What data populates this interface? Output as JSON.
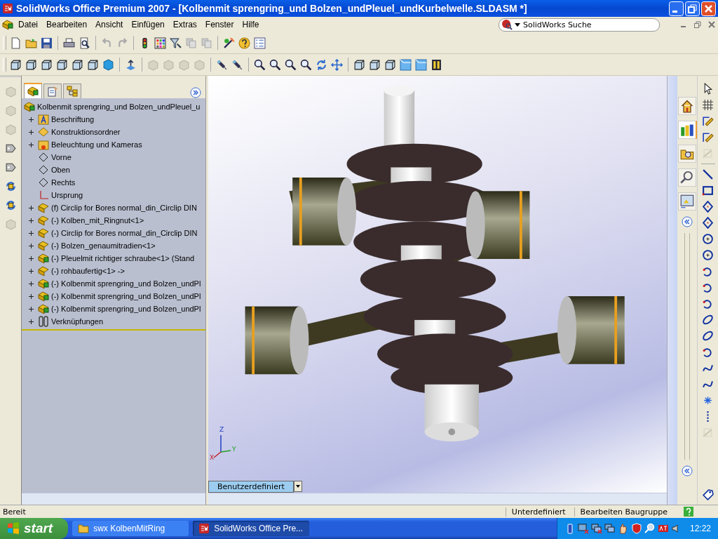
{
  "window": {
    "title": "SolidWorks Office Premium 2007 - [Kolbenmit sprengring_und Bolzen_undPleuel_undKurbelwelle.SLDASM *]"
  },
  "menu": [
    "Datei",
    "Bearbeiten",
    "Ansicht",
    "Einfügen",
    "Extras",
    "Fenster",
    "Hilfe"
  ],
  "search": {
    "placeholder": "SolidWorks Suche"
  },
  "feature_tree": {
    "tabs": [
      {
        "kind": "feature",
        "selected": true
      },
      {
        "kind": "property",
        "selected": false
      },
      {
        "kind": "config",
        "selected": false
      }
    ],
    "root": "Kolbenmit sprengring_und Bolzen_undPleuel_u",
    "items": [
      {
        "label": "Beschriftung",
        "kind": "annotations",
        "expandable": true
      },
      {
        "label": "Konstruktionsordner",
        "kind": "design",
        "expandable": true
      },
      {
        "label": "Beleuchtung und Kameras",
        "kind": "lights",
        "expandable": true
      },
      {
        "label": "Vorne",
        "kind": "plane",
        "expandable": false
      },
      {
        "label": "Oben",
        "kind": "plane",
        "expandable": false
      },
      {
        "label": "Rechts",
        "kind": "plane",
        "expandable": false
      },
      {
        "label": "Ursprung",
        "kind": "origin",
        "expandable": false
      },
      {
        "label": "(f) Circlip for Bores normal_din_Circlip DIN",
        "kind": "part",
        "expandable": true
      },
      {
        "label": "(-) Kolben_mit_Ringnut<1>",
        "kind": "part",
        "expandable": true
      },
      {
        "label": "(-) Circlip for Bores normal_din_Circlip DIN",
        "kind": "part",
        "expandable": true
      },
      {
        "label": "(-) Bolzen_genaumitradien<1>",
        "kind": "part",
        "expandable": true
      },
      {
        "label": "(-) Pleuelmit richtiger schraube<1> (Stand",
        "kind": "assembly",
        "expandable": true
      },
      {
        "label": "(-) rohbaufertig<1> ->",
        "kind": "part",
        "expandable": true
      },
      {
        "label": "(-) Kolbenmit sprengring_und Bolzen_undPl",
        "kind": "assembly",
        "expandable": true
      },
      {
        "label": "(-) Kolbenmit sprengring_und Bolzen_undPl",
        "kind": "assembly",
        "expandable": true
      },
      {
        "label": "(-) Kolbenmit sprengring_und Bolzen_undPl",
        "kind": "assembly",
        "expandable": true
      },
      {
        "label": "Verknüpfungen",
        "kind": "mates",
        "expandable": true
      }
    ]
  },
  "viewport": {
    "triad": [
      "Z",
      "Y",
      "X"
    ],
    "view_tabs": [
      {
        "label": "Benutzerdefiniert",
        "selected": true
      }
    ]
  },
  "status_bar": [
    "Bereit",
    "Unterdefiniert",
    "Bearbeiten Baugruppe"
  ],
  "taskbar": {
    "start": "start",
    "tasks": [
      {
        "label": "swx KolbenMitRing",
        "kind": "folder",
        "selected": false
      },
      {
        "label": "SolidWorks Office Pre...",
        "kind": "app",
        "selected": true
      }
    ],
    "clock": "12:22"
  }
}
